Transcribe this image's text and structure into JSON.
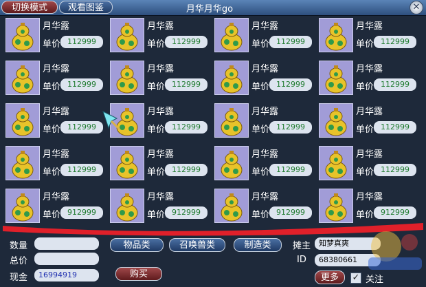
{
  "titlebar": {
    "mode_button": "切换模式",
    "view_button": "观看图鉴",
    "title": "月华月华go",
    "close": "✕"
  },
  "items": [
    {
      "name": "月华露",
      "price_label": "单价",
      "price": "112999"
    },
    {
      "name": "月华露",
      "price_label": "单价",
      "price": "112999"
    },
    {
      "name": "月华露",
      "price_label": "单价",
      "price": "112999"
    },
    {
      "name": "月华露",
      "price_label": "单价",
      "price": "112999"
    },
    {
      "name": "月华露",
      "price_label": "单价",
      "price": "112999"
    },
    {
      "name": "月华露",
      "price_label": "单价",
      "price": "112999"
    },
    {
      "name": "月华露",
      "price_label": "单价",
      "price": "112999"
    },
    {
      "name": "月华露",
      "price_label": "单价",
      "price": "112999"
    },
    {
      "name": "月华露",
      "price_label": "单价",
      "price": "112999"
    },
    {
      "name": "月华露",
      "price_label": "单价",
      "price": "112999"
    },
    {
      "name": "月华露",
      "price_label": "单价",
      "price": "112999"
    },
    {
      "name": "月华露",
      "price_label": "单价",
      "price": "112999"
    },
    {
      "name": "月华露",
      "price_label": "单价",
      "price": "112999"
    },
    {
      "name": "月华露",
      "price_label": "单价",
      "price": "112999"
    },
    {
      "name": "月华露",
      "price_label": "单价",
      "price": "112999"
    },
    {
      "name": "月华露",
      "price_label": "单价",
      "price": "112999"
    },
    {
      "name": "月华露",
      "price_label": "单价",
      "price": "912999"
    },
    {
      "name": "月华露",
      "price_label": "单价",
      "price": "912999"
    },
    {
      "name": "月华露",
      "price_label": "单价",
      "price": "912999"
    },
    {
      "name": "月华露",
      "price_label": "单价",
      "price": "912999"
    }
  ],
  "footer": {
    "qty_label": "数量",
    "qty_value": "",
    "total_label": "总价",
    "total_value": "",
    "cash_label": "现金",
    "cash_value": "16994919",
    "tab_goods": "物品类",
    "tab_pets": "召唤兽类",
    "tab_craft": "制造类",
    "buy": "购买",
    "owner_label": "摊主",
    "owner_value": "知梦真爽",
    "id_label": "ID",
    "id_value": "68380661",
    "more": "更多",
    "check_mark": "✓",
    "follow": "关注"
  },
  "colors": {
    "price_text": "#1d7a2d",
    "cash_text": "#1f2fb0",
    "cell_bg": "#a19cd7",
    "redline": "#e0202a"
  },
  "icons": {
    "item": "gourd-icon",
    "close": "close-icon",
    "cursor": "sword-cursor-icon"
  }
}
